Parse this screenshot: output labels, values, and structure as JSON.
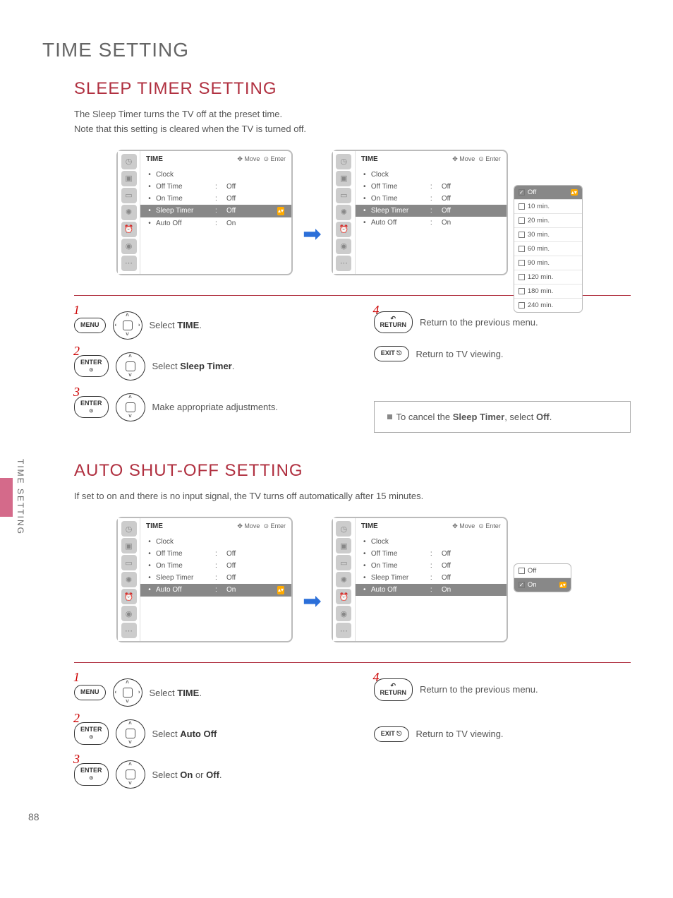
{
  "page_title": "TIME SETTING",
  "side_label": "TIME SETTING",
  "page_number": "88",
  "sleep": {
    "title": "SLEEP TIMER SETTING",
    "intro1": "The Sleep Timer turns the TV off at the preset time.",
    "intro2": "Note that this setting is cleared when the TV is turned off.",
    "osd": {
      "header": "TIME",
      "hints_move": "Move",
      "hints_enter": "Enter",
      "rows": [
        {
          "label": "Clock",
          "value": ""
        },
        {
          "label": "Off Time",
          "value": "Off"
        },
        {
          "label": "On Time",
          "value": "Off"
        },
        {
          "label": "Sleep Timer",
          "value": "Off",
          "selected": true
        },
        {
          "label": "Auto Off",
          "value": "On"
        }
      ]
    },
    "options": [
      "Off",
      "10 min.",
      "20 min.",
      "30 min.",
      "60 min.",
      "90 min.",
      "120 min.",
      "180 min.",
      "240 min."
    ],
    "steps_left": [
      {
        "num": "1",
        "btn1": "MENU",
        "dpad": "lr",
        "text_pre": "Select ",
        "bold": "TIME",
        "text_post": "."
      },
      {
        "num": "2",
        "btn1": "ENTER",
        "dpad": "ud",
        "text_pre": "Select ",
        "bold": "Sleep Timer",
        "text_post": "."
      },
      {
        "num": "3",
        "btn1": "ENTER",
        "dpad": "ud",
        "text_pre": "Make appropriate adjustments.",
        "bold": "",
        "text_post": ""
      }
    ],
    "steps_right": [
      {
        "num": "4",
        "btn1": "RETURN",
        "text": "Return to the previous menu."
      },
      {
        "btn1": "EXIT",
        "text": "Return to TV viewing."
      }
    ],
    "note_pre": "To cancel the ",
    "note_bold1": "Sleep Timer",
    "note_mid": ", select ",
    "note_bold2": "Off",
    "note_post": "."
  },
  "auto": {
    "title": "AUTO SHUT-OFF SETTING",
    "intro1": "If set to on and there is no input signal, the TV turns off automatically after 15 minutes.",
    "osd": {
      "header": "TIME",
      "hints_move": "Move",
      "hints_enter": "Enter",
      "rows": [
        {
          "label": "Clock",
          "value": ""
        },
        {
          "label": "Off Time",
          "value": "Off"
        },
        {
          "label": "On Time",
          "value": "Off"
        },
        {
          "label": "Sleep Timer",
          "value": "Off"
        },
        {
          "label": "Auto Off",
          "value": "On",
          "selected": true
        }
      ]
    },
    "options": [
      "Off",
      "On"
    ],
    "steps_left": [
      {
        "num": "1",
        "btn1": "MENU",
        "dpad": "lr",
        "text_pre": "Select ",
        "bold": "TIME",
        "text_post": "."
      },
      {
        "num": "2",
        "btn1": "ENTER",
        "dpad": "ud",
        "text_pre": "Select ",
        "bold": "Auto Off",
        "text_post": ""
      },
      {
        "num": "3",
        "btn1": "ENTER",
        "dpad": "ud",
        "text_pre": "Select ",
        "bold": "On",
        "text_post": " or ",
        "bold2": "Off",
        "text_post2": "."
      }
    ],
    "steps_right": [
      {
        "num": "4",
        "btn1": "RETURN",
        "text": "Return to the previous menu."
      },
      {
        "btn1": "EXIT",
        "text": "Return to TV viewing."
      }
    ]
  }
}
